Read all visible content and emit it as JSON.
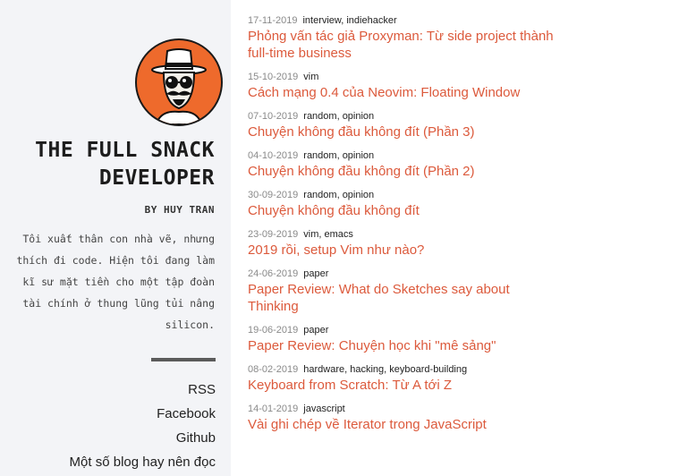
{
  "site": {
    "title": "THE FULL SNACK DEVELOPER",
    "byline": "BY HUY TRAN",
    "bio": "Tôi xuất thân con nhà vẽ, nhưng thích đi code. Hiện tôi đang làm kĩ sư mặt tiền cho một tập đoàn tài chính ở thung lũng tủi nâng silicon."
  },
  "nav": [
    {
      "label": "RSS"
    },
    {
      "label": "Facebook"
    },
    {
      "label": "Github"
    },
    {
      "label": "Một số blog hay nên đọc"
    }
  ],
  "posts": [
    {
      "date": "17-11-2019",
      "tags": "interview, indiehacker",
      "title": "Phỏng vấn tác giả Proxyman: Từ side project thành full-time business"
    },
    {
      "date": "15-10-2019",
      "tags": "vim",
      "title": "Cách mạng 0.4 của Neovim: Floating Window"
    },
    {
      "date": "07-10-2019",
      "tags": "random, opinion",
      "title": "Chuyện không đầu không đít (Phần 3)"
    },
    {
      "date": "04-10-2019",
      "tags": "random, opinion",
      "title": "Chuyện không đầu không đít (Phần 2)"
    },
    {
      "date": "30-09-2019",
      "tags": "random, opinion",
      "title": "Chuyện không đầu không đít"
    },
    {
      "date": "23-09-2019",
      "tags": "vim, emacs",
      "title": "2019 rồi, setup Vim như nào?"
    },
    {
      "date": "24-06-2019",
      "tags": "paper",
      "title": "Paper Review: What do Sketches say about Thinking"
    },
    {
      "date": "19-06-2019",
      "tags": "paper",
      "title": "Paper Review: Chuyện học khi \"mê sảng\""
    },
    {
      "date": "08-02-2019",
      "tags": "hardware, hacking, keyboard-building",
      "title": "Keyboard from Scratch: Từ A tới Z"
    },
    {
      "date": "14-01-2019",
      "tags": "javascript",
      "title": "Vài ghi chép về Iterator trong JavaScript"
    }
  ],
  "colors": {
    "accent": "#dc5a3c",
    "avatar_bg": "#ee6a2c",
    "sidebar_bg": "#f3f4f7"
  },
  "icons": {
    "avatar": "hat-mustache-character-avatar"
  }
}
